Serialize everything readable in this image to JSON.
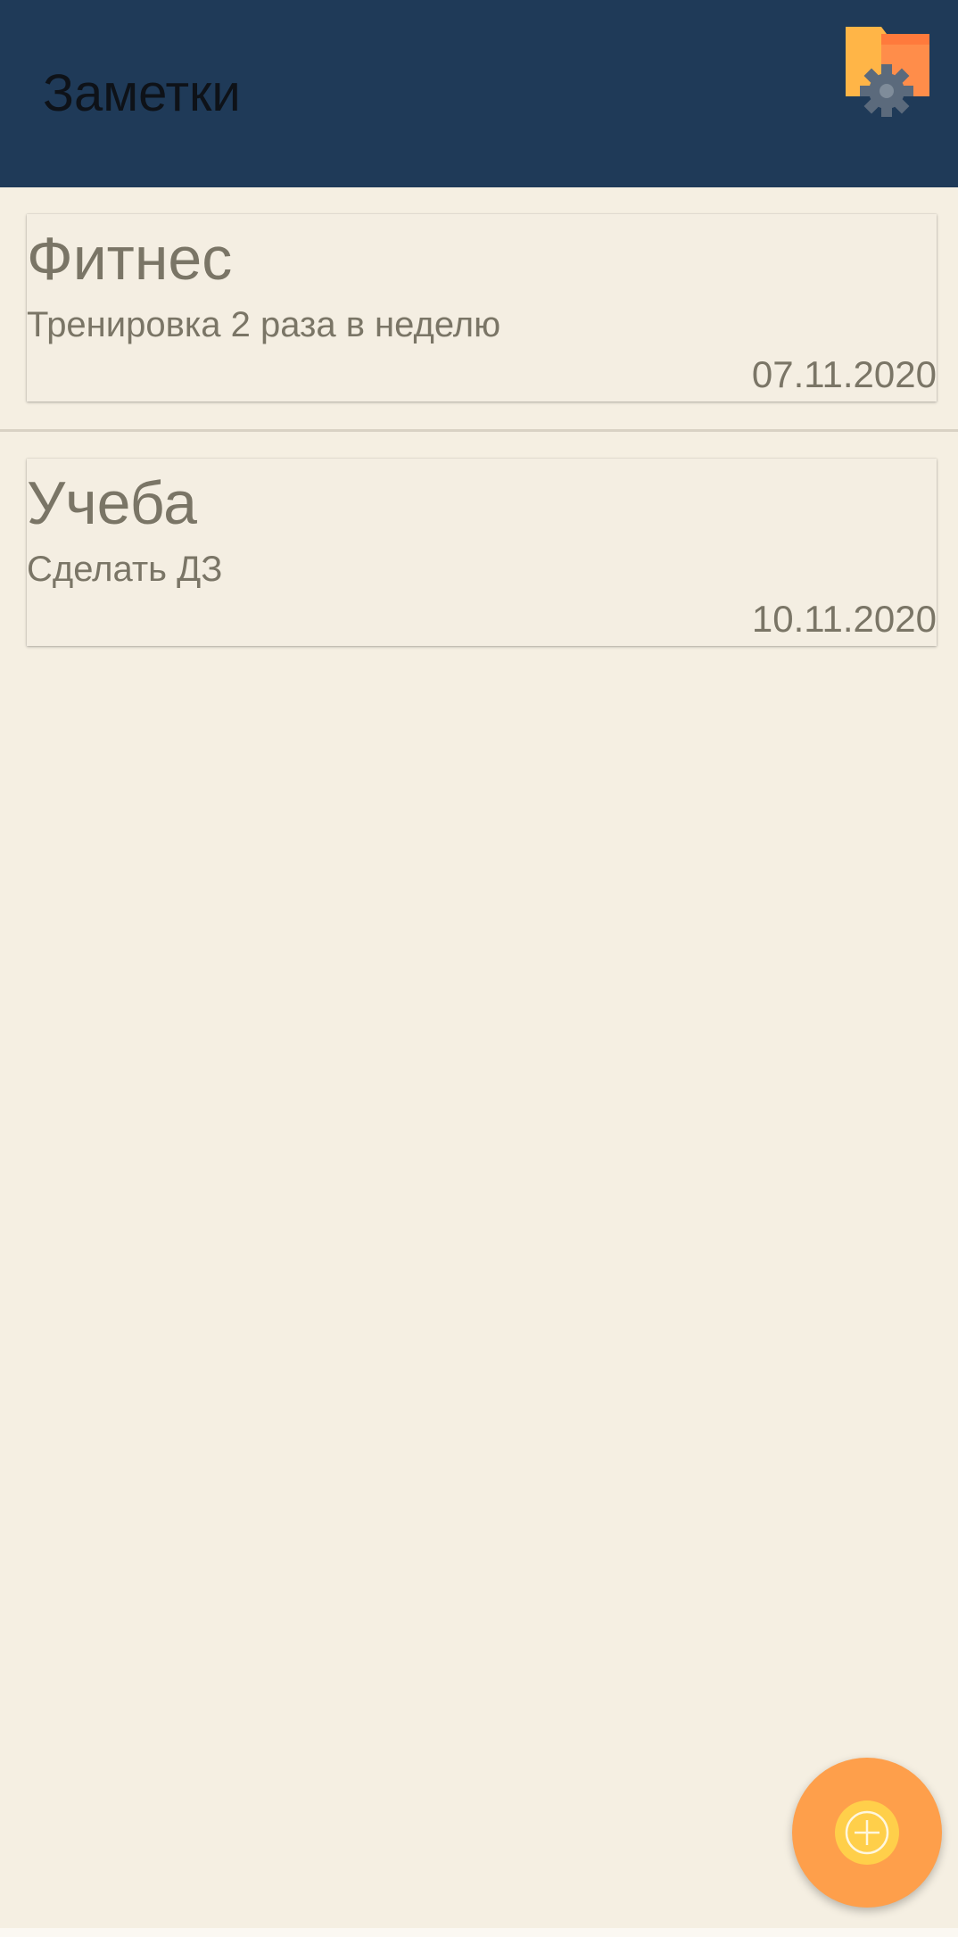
{
  "app_bar": {
    "title": "Заметки",
    "background": "#1F3A58",
    "settings_icon": "folder-gear-icon"
  },
  "notes": [
    {
      "title": "Фитнес",
      "body": "Тренировка 2 раза в неделю",
      "date": "07.11.2020"
    },
    {
      "title": "Учеба",
      "body": "Сделать ДЗ",
      "date": "10.11.2020"
    }
  ],
  "fab": {
    "icon": "add-circle-icon",
    "color": "#FE9F4B"
  },
  "colors": {
    "background": "#F5EFE2",
    "text_muted": "#7A7566"
  }
}
